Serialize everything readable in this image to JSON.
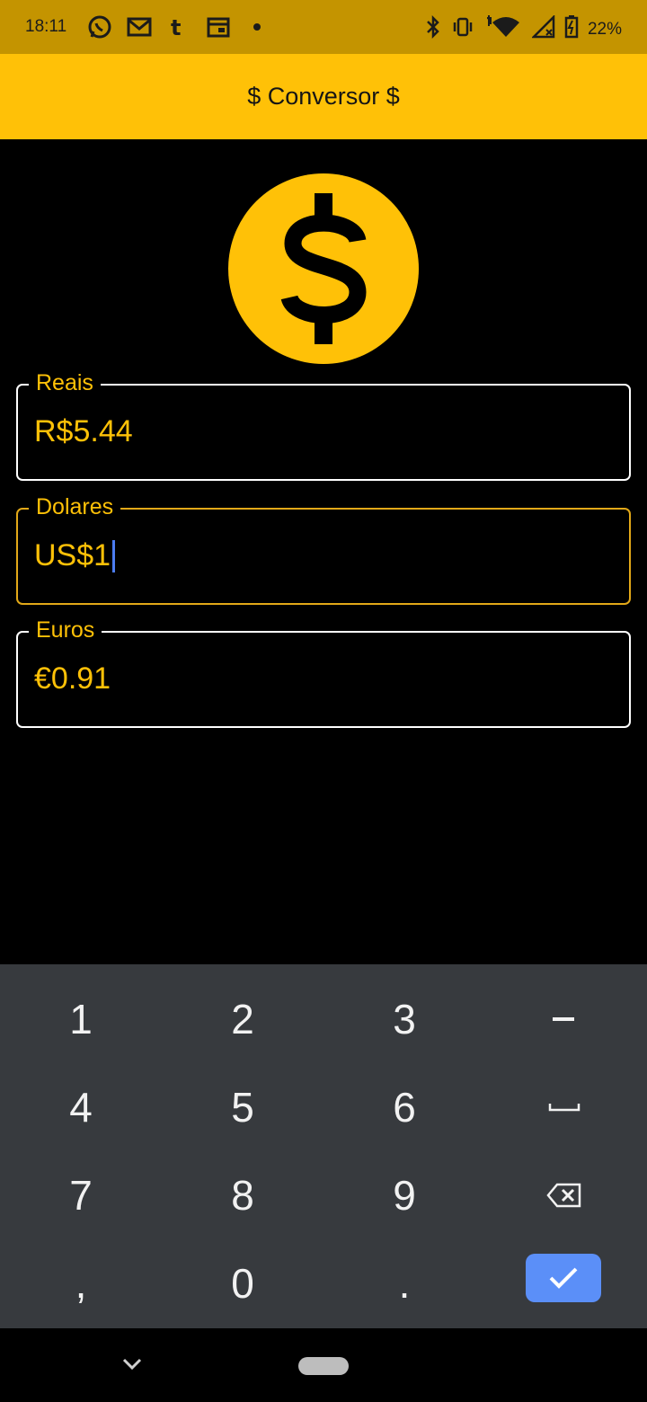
{
  "status_bar": {
    "time": "18:11",
    "battery": "22%",
    "left_icons": [
      "whatsapp-icon",
      "gmail-icon",
      "tumblr-icon",
      "calendar-icon",
      "more-dot-icon"
    ],
    "right_icons": [
      "bluetooth-icon",
      "vibrate-icon",
      "wifi-icon",
      "signal-icon",
      "battery-icon"
    ]
  },
  "app_bar": {
    "title": "$ Conversor $"
  },
  "logo": {
    "icon": "dollar-coin-icon",
    "color": "#ffc107"
  },
  "fields": [
    {
      "label": "Reais",
      "value": "R$5.44",
      "focused": false
    },
    {
      "label": "Dolares",
      "value": "US$1",
      "focused": true
    },
    {
      "label": "Euros",
      "value": "€0.91",
      "focused": false
    }
  ],
  "keyboard": {
    "rows": [
      [
        "1",
        "2",
        "3",
        "−"
      ],
      [
        "4",
        "5",
        "6",
        "␣"
      ],
      [
        "7",
        "8",
        "9",
        "⌫"
      ],
      [
        ",",
        "0",
        ".",
        "✓"
      ]
    ]
  },
  "colors": {
    "accent": "#ffc107",
    "status_bar": "#c49400",
    "keyboard_bg": "#373a3e",
    "done_key": "#5b8ff8"
  }
}
